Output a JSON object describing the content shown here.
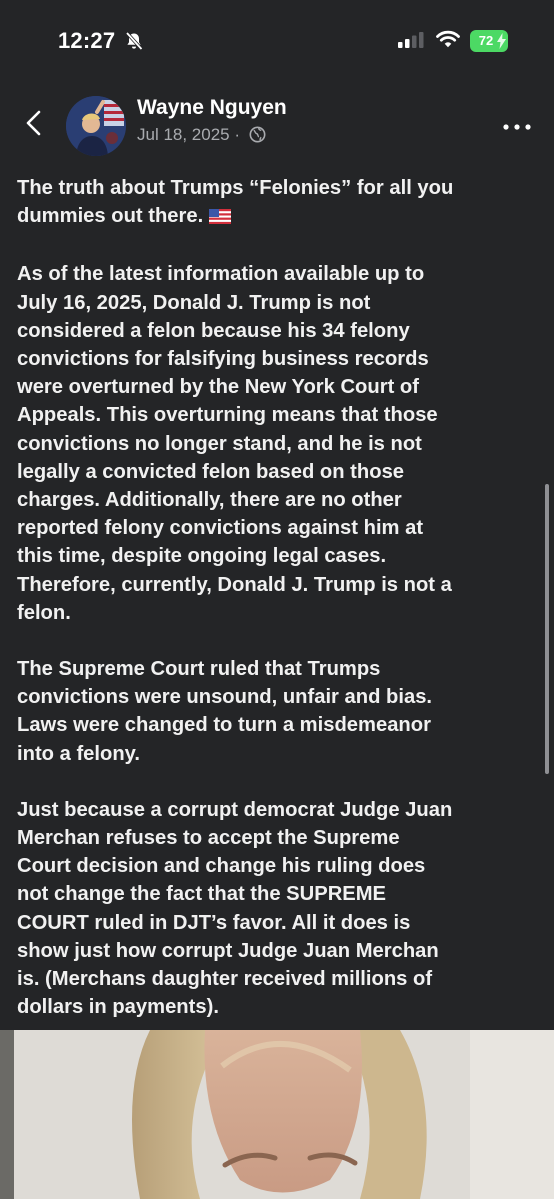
{
  "status_bar": {
    "time": "12:27",
    "battery": "72",
    "icons": [
      "bell-off-icon",
      "cellular-signal-icon",
      "wifi-icon",
      "battery-icon"
    ]
  },
  "header": {
    "author": "Wayne Nguyen",
    "date": "Jul 18, 2025 ·",
    "icons": [
      "back-chevron-icon",
      "globe-icon",
      "more-icon"
    ]
  },
  "post": {
    "paragraphs": [
      {
        "lines": [
          "The truth about Trumps “Felonies” for all you",
          "dummies out there."
        ]
      },
      {
        "lines": [
          "As of the latest information available up to",
          "July 16, 2025, Donald J. Trump is not",
          "considered a felon because his 34 felony",
          "convictions for falsifying business records",
          "were overturned by the New York Court of",
          "Appeals. This overturning means that those",
          "convictions no longer stand, and he is not",
          "legally a convicted felon based on those",
          "charges. Additionally, there are no other",
          "reported felony convictions against him at",
          "this time, despite ongoing legal cases.",
          "Therefore, currently, Donald J. Trump is not a",
          "felon."
        ]
      },
      {
        "lines": [
          "The Supreme Court ruled that Trumps",
          "convictions were unsound, unfair and bias.",
          "Laws were changed to turn a misdemeanor",
          "into a felony."
        ]
      },
      {
        "lines": [
          "Just because a corrupt democrat Judge Juan",
          "Merchan refuses to accept the Supreme",
          "Court decision and change his ruling does",
          "not change the fact that the SUPREME",
          "COURT ruled in DJT’s favor. All it does is",
          "show just how corrupt Judge Juan Merchan",
          "is. (Merchans  daughter received millions of",
          "dollars in payments)."
        ]
      }
    ],
    "emoji": "us-flag-emoji"
  },
  "colors": {
    "background": "#242527",
    "text": "#f1f1f1",
    "secondary_text": "#a9abaf",
    "battery": "#4cd964"
  }
}
